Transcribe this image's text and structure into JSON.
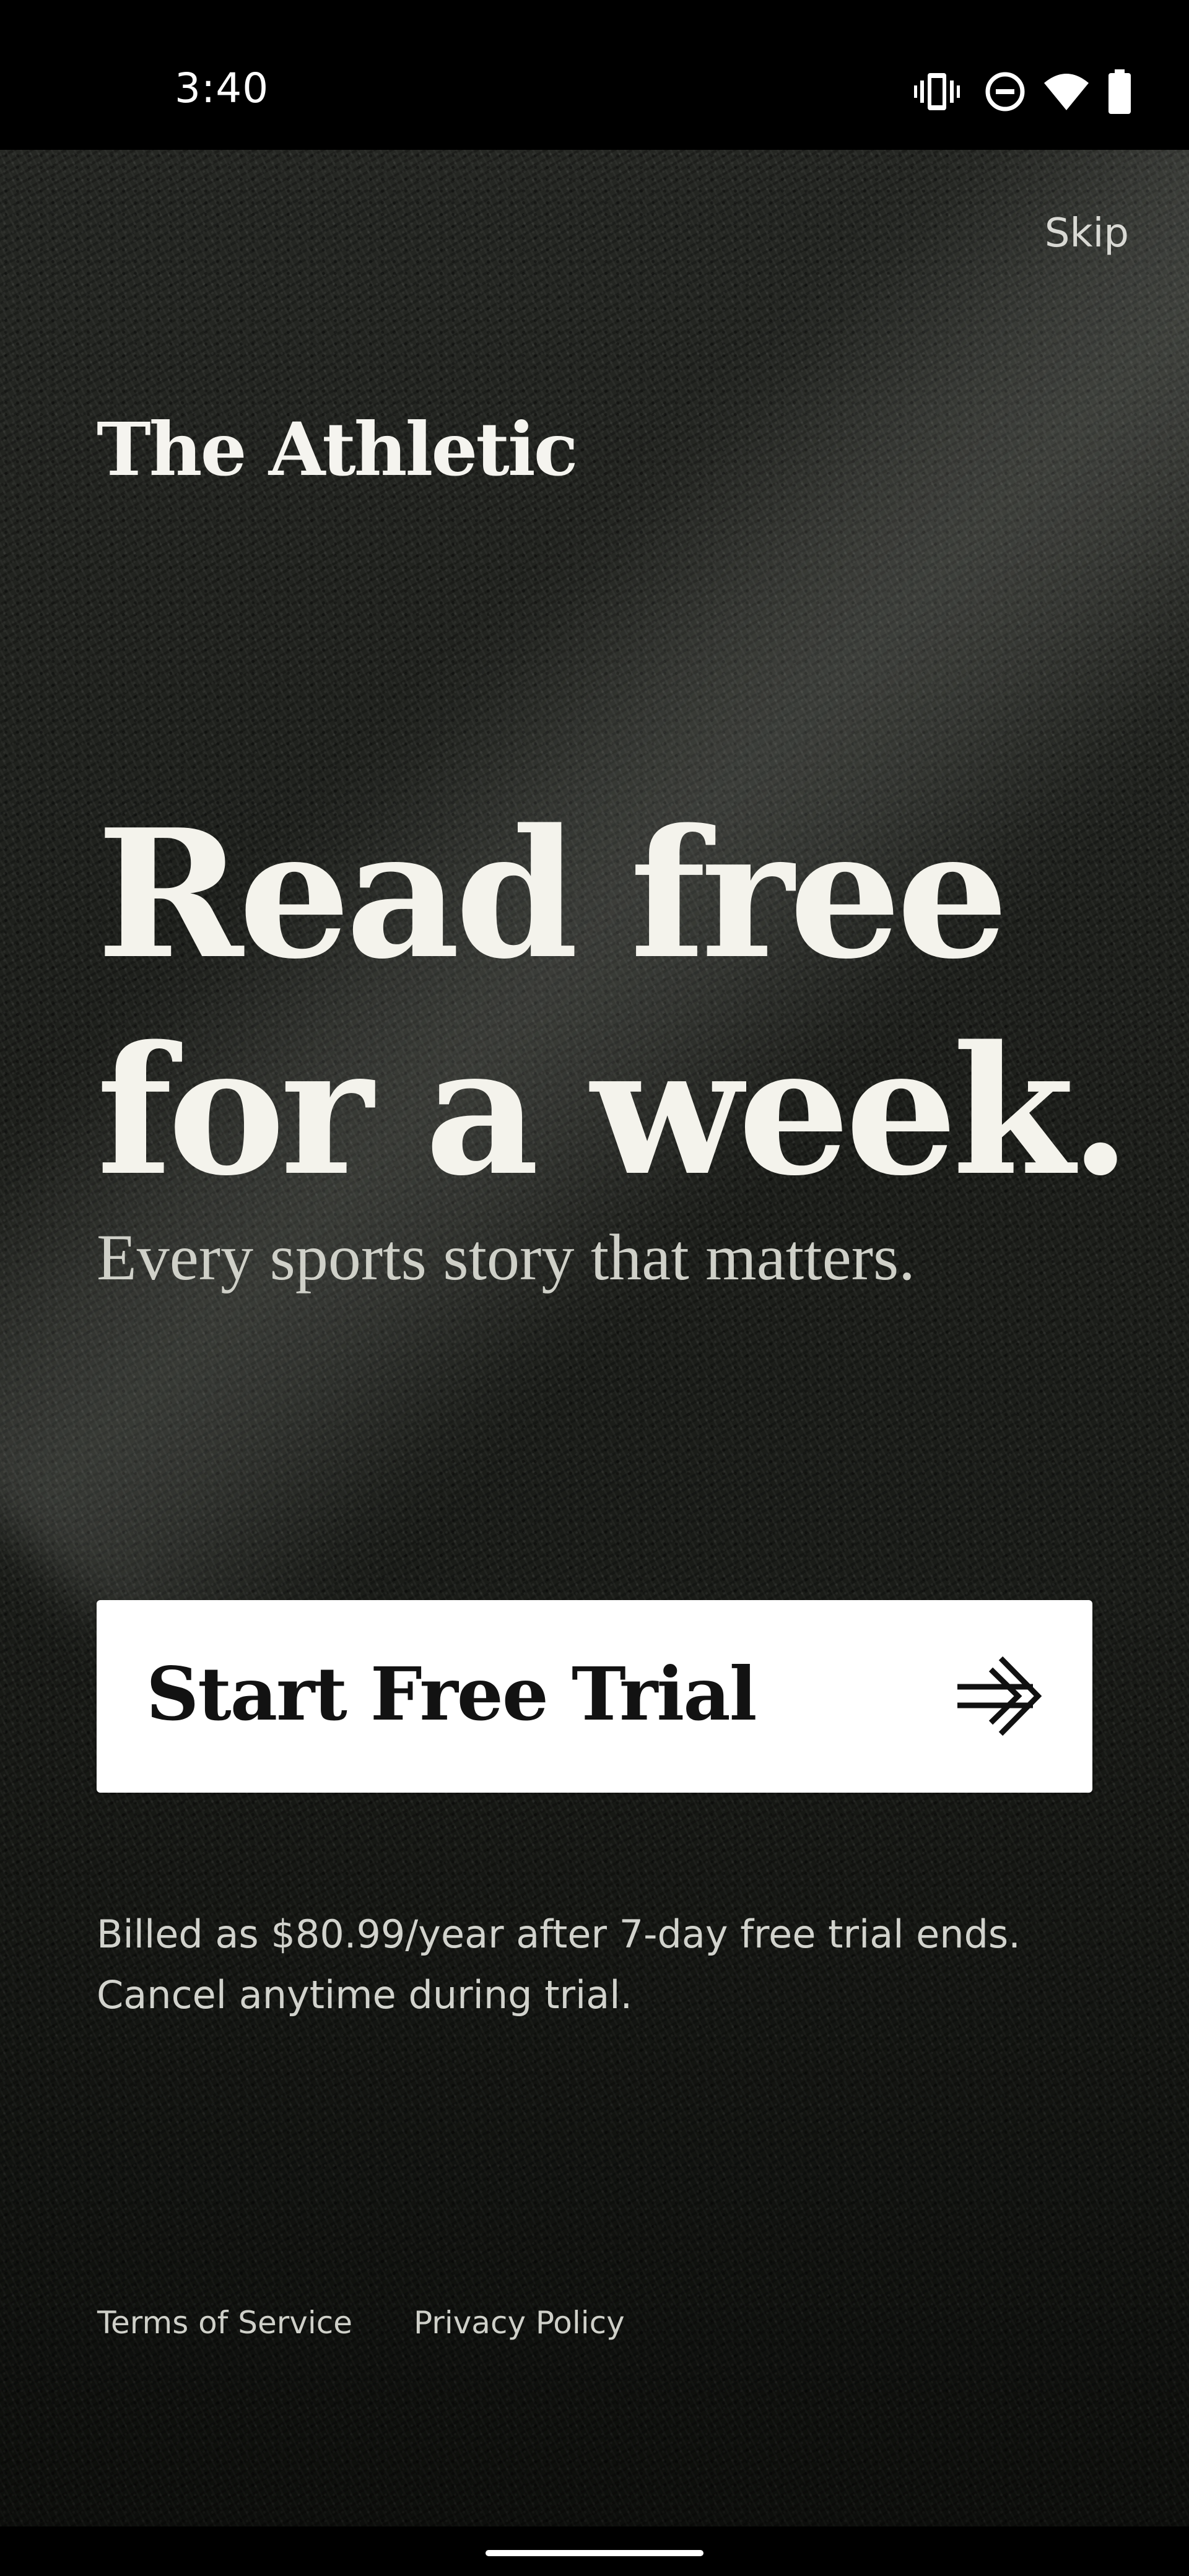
{
  "status_bar": {
    "time": "3:40",
    "icons": [
      "vibrate-icon",
      "do-not-disturb-icon",
      "wifi-icon",
      "battery-icon"
    ]
  },
  "header": {
    "skip_label": "Skip",
    "brand": "The Athletic"
  },
  "hero": {
    "headline_line1": "Read free",
    "headline_line2": "for a week.",
    "subheadline": "Every sports story that matters."
  },
  "cta": {
    "label": "Start Free Trial",
    "icon": "arrow-right-icon"
  },
  "billing": {
    "line1": "Billed as $80.99/year after 7-day free trial ends.",
    "line2": "Cancel anytime during trial."
  },
  "footer": {
    "terms_label": "Terms of Service",
    "privacy_label": "Privacy Policy"
  },
  "colors": {
    "background": "#1a1c19",
    "text_primary": "#f4f3ec",
    "button_bg": "#ffffff",
    "button_text": "#121212"
  }
}
